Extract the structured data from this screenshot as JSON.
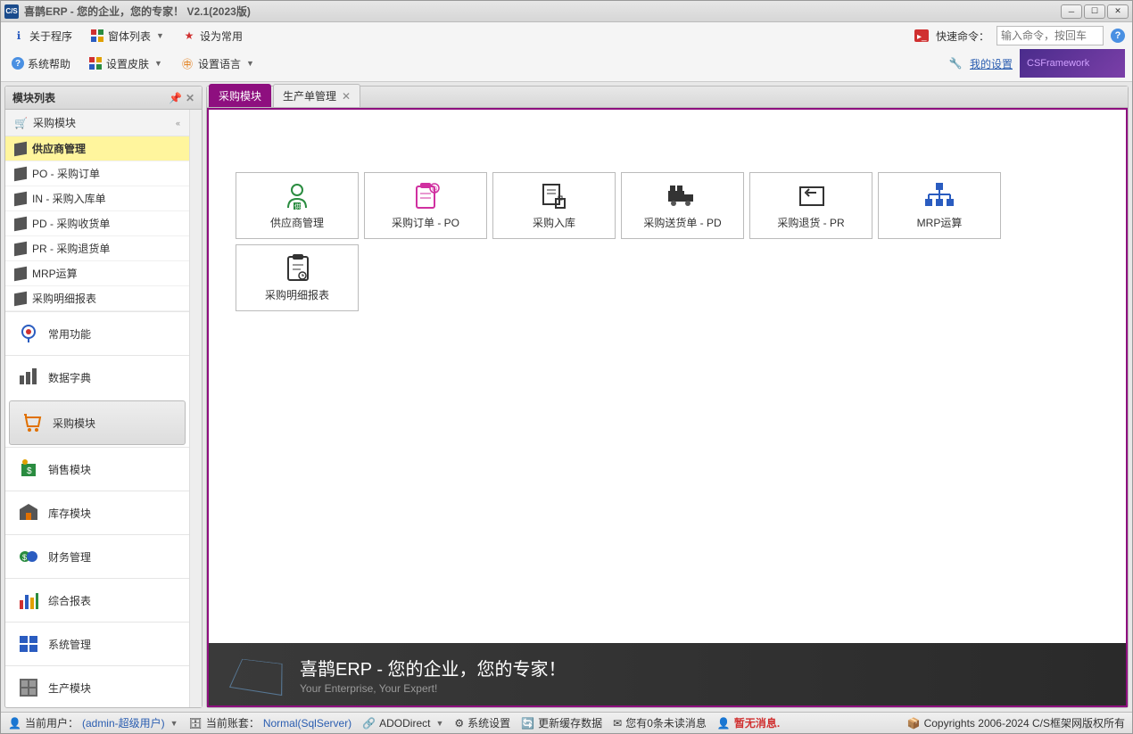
{
  "window": {
    "title": "喜鹊ERP - 您的企业，您的专家！ V2.1(2023版)",
    "logo_text": "C/S"
  },
  "toolbar": {
    "row1": {
      "about": "关于程序",
      "window_list": "窗体列表",
      "set_common": "设为常用"
    },
    "row2": {
      "sys_help": "系统帮助",
      "set_skin": "设置皮肤",
      "set_lang": "设置语言"
    },
    "right": {
      "quick_cmd_label": "快速命令：",
      "quick_cmd_placeholder": "输入命令，按回车",
      "my_settings": "我的设置",
      "csf": "CSFramework"
    }
  },
  "sidebar": {
    "title": "模块列表",
    "current_module_head": "采购模块",
    "tree": [
      {
        "label": "供应商管理",
        "active": true
      },
      {
        "label": "PO - 采购订单"
      },
      {
        "label": "IN - 采购入库单"
      },
      {
        "label": "PD - 采购收货单"
      },
      {
        "label": "PR - 采购退货单"
      },
      {
        "label": "MRP运算"
      },
      {
        "label": "采购明细报表"
      }
    ],
    "nav": [
      {
        "label": "常用功能",
        "icon": "pin"
      },
      {
        "label": "数据字典",
        "icon": "dict"
      },
      {
        "label": "采购模块",
        "icon": "cart",
        "selected": true
      },
      {
        "label": "销售模块",
        "icon": "sale"
      },
      {
        "label": "库存模块",
        "icon": "stock"
      },
      {
        "label": "财务管理",
        "icon": "finance"
      },
      {
        "label": "综合报表",
        "icon": "report"
      },
      {
        "label": "系统管理",
        "icon": "system"
      },
      {
        "label": "生产模块",
        "icon": "prod"
      }
    ]
  },
  "tabs": [
    {
      "label": "采购模块",
      "active": true,
      "closable": false
    },
    {
      "label": "生产单管理",
      "closable": true
    }
  ],
  "tiles": [
    {
      "label": "供应商管理",
      "color": "#2a8c40"
    },
    {
      "label": "采购订单 - PO",
      "color": "#d030a0"
    },
    {
      "label": "采购入库",
      "color": "#333"
    },
    {
      "label": "采购送货单 - PD",
      "color": "#333"
    },
    {
      "label": "采购退货 - PR",
      "color": "#333"
    },
    {
      "label": "MRP运算",
      "color": "#2a5cc0"
    },
    {
      "label": "采购明细报表",
      "color": "#333"
    }
  ],
  "banner": {
    "title": "喜鹊ERP - 您的企业，您的专家！",
    "sub": "Your Enterprise, Your Expert!"
  },
  "status": {
    "user_label": "当前用户：",
    "user_value": "(admin-超级用户)",
    "db_label": "当前账套：",
    "db_value": "Normal(SqlServer)",
    "ado": "ADODirect",
    "sys_settings": "系统设置",
    "refresh": "更新缓存数据",
    "unread": "您有0条未读消息",
    "no_msg": "暂无消息.",
    "copyright": "Copyrights 2006-2024 C/S框架网版权所有"
  }
}
